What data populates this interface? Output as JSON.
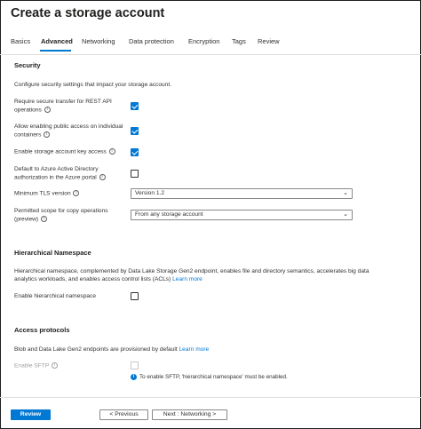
{
  "header": {
    "title": "Create a storage account",
    "more": "···"
  },
  "tabs": [
    {
      "label": "Basics"
    },
    {
      "label": "Advanced"
    },
    {
      "label": "Networking"
    },
    {
      "label": "Data protection"
    },
    {
      "label": "Encryption"
    },
    {
      "label": "Tags"
    },
    {
      "label": "Review"
    }
  ],
  "security": {
    "title": "Security",
    "description": "Configure security settings that impact your storage account.",
    "secure_transfer": {
      "label": "Require secure transfer for REST API operations",
      "checked": true
    },
    "public_access": {
      "label": "Allow enabling public access on individual containers",
      "checked": true
    },
    "key_access": {
      "label": "Enable storage account key access",
      "checked": true
    },
    "aad_default": {
      "label": "Default to Azure Active Directory authorization in the Azure portal",
      "checked": false
    },
    "tls": {
      "label": "Minimum TLS version",
      "value": "Version 1.2"
    },
    "copy_scope": {
      "label": "Permitted scope for copy operations (preview)",
      "value": "From any storage account"
    }
  },
  "hns": {
    "title": "Hierarchical Namespace",
    "description": "Hierarchical namespace, complemented by Data Lake Storage Gen2 endpoint, enables file and directory semantics, accelerates big data analytics workloads, and enables access control lists (ACLs)",
    "learn_more": "Learn more",
    "enable": {
      "label": "Enable hierarchical namespace",
      "checked": false
    }
  },
  "access": {
    "title": "Access protocols",
    "description": "Blob and Data Lake Gen2 endpoints are provisioned by default",
    "learn_more": "Learn more",
    "sftp": {
      "label": "Enable SFTP",
      "checked": false
    },
    "note": "To enable SFTP, 'hierarchical namespace' must be enabled."
  },
  "footer": {
    "review": "Review",
    "previous": "< Previous",
    "next": "Next : Networking >"
  },
  "colors": {
    "accent": "#0078d4",
    "text": "#323130",
    "disabled": "#a19f9d"
  },
  "icons": {
    "info": "info-icon",
    "chevron": "chevron-down-icon",
    "checkmark": "checkmark-icon"
  }
}
